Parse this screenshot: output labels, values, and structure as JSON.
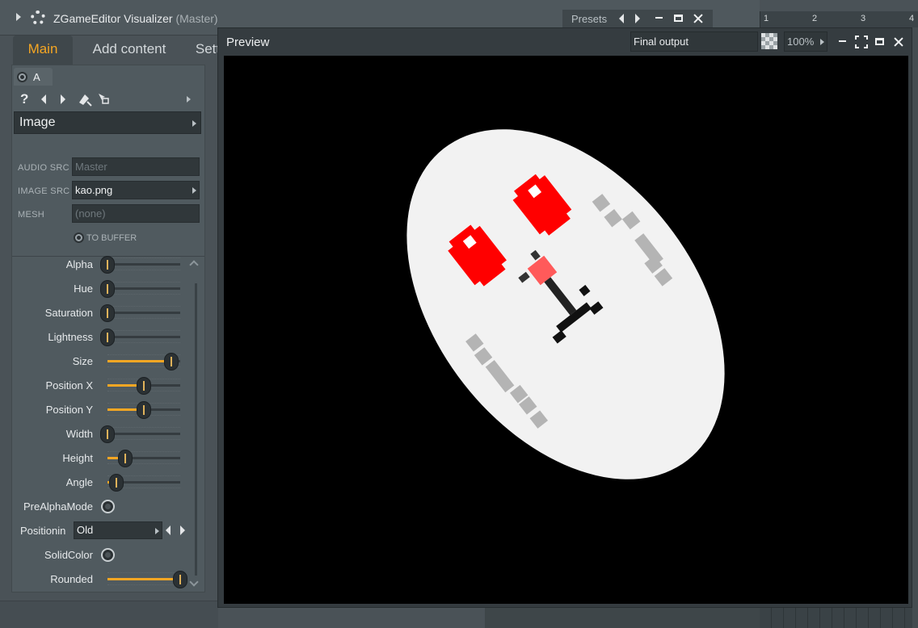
{
  "window": {
    "title": "ZGameEditor Visualizer",
    "subtitle": "(Master)",
    "presets_label": "Presets"
  },
  "ruler": {
    "marks": [
      "1",
      "2",
      "3",
      "4"
    ]
  },
  "tabs": [
    {
      "label": "Main",
      "active": true
    },
    {
      "label": "Add content",
      "active": false
    },
    {
      "label": "Sett",
      "active": false
    }
  ],
  "panel": {
    "layer_label": "A",
    "help_label": "?",
    "module": "Image",
    "sources": [
      {
        "label": "AUDIO SRC",
        "value": "Master",
        "enabled": false
      },
      {
        "label": "IMAGE SRC",
        "value": "kao.png",
        "enabled": true
      },
      {
        "label": "MESH",
        "value": "(none)",
        "enabled": false
      }
    ],
    "to_buffer_label": "TO BUFFER",
    "params": [
      {
        "label": "Alpha",
        "value": 0.0
      },
      {
        "label": "Hue",
        "value": 0.0
      },
      {
        "label": "Saturation",
        "value": 0.0
      },
      {
        "label": "Lightness",
        "value": 0.0
      },
      {
        "label": "Size",
        "value": 0.88
      },
      {
        "label": "Position X",
        "value": 0.5
      },
      {
        "label": "Position Y",
        "value": 0.5
      },
      {
        "label": "Width",
        "value": 0.0
      },
      {
        "label": "Height",
        "value": 0.24
      },
      {
        "label": "Angle",
        "value": 0.12
      }
    ],
    "prealpha_label": "PreAlphaMode",
    "positioning_label": "Positionin",
    "positioning_value": "Old",
    "solidcolor_label": "SolidColor",
    "rounded_label": "Rounded",
    "rounded_value": 1.0
  },
  "preview": {
    "title": "Preview",
    "output_select": "Final output",
    "zoom": "100%"
  },
  "colors": {
    "accent": "#f5a623",
    "panel_bg": "#505a5f",
    "canvas_bg": "#000000",
    "face_fill": "#f2f2f2",
    "eye_red": "#ff0000"
  }
}
